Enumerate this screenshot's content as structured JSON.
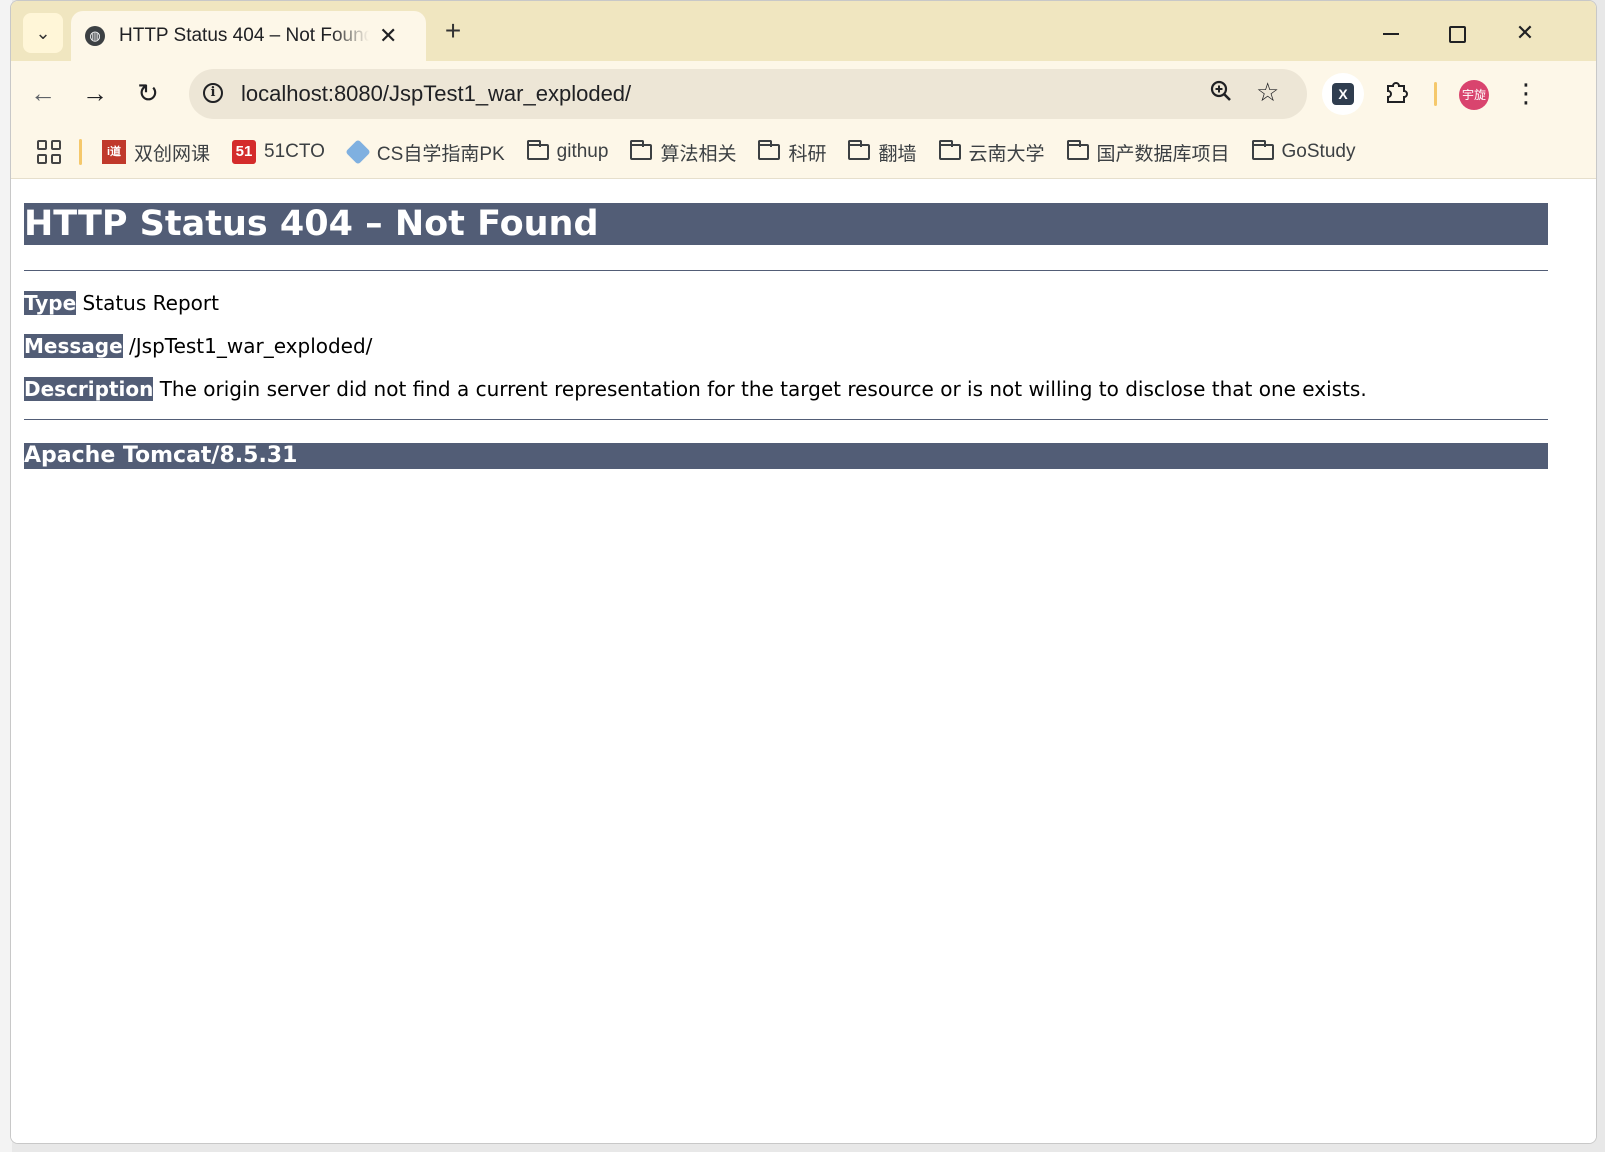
{
  "tab": {
    "title": "HTTP Status 404 – Not Found",
    "close": "✕"
  },
  "window_controls": {
    "minimize": "—",
    "maximize": "☐",
    "close": "✕"
  },
  "toolbar": {
    "url": "localhost:8080/JspTest1_war_exploded/",
    "avatar_text": "宇旋"
  },
  "bookmarks": [
    {
      "label": "双创网课",
      "icon": "shuangchuang-icon"
    },
    {
      "label": "51CTO",
      "icon": "51cto-icon"
    },
    {
      "label": "CS自学指南PK",
      "icon": "cube-icon"
    },
    {
      "label": "githup",
      "icon": "folder-icon"
    },
    {
      "label": "算法相关",
      "icon": "folder-icon"
    },
    {
      "label": "科研",
      "icon": "folder-icon"
    },
    {
      "label": "翻墙",
      "icon": "folder-icon"
    },
    {
      "label": "云南大学",
      "icon": "folder-icon"
    },
    {
      "label": "国产数据库项目",
      "icon": "folder-icon"
    },
    {
      "label": "GoStudy",
      "icon": "folder-icon"
    }
  ],
  "page": {
    "heading": "HTTP Status 404 – Not Found",
    "type_label": "Type",
    "type_value": "Status Report",
    "message_label": "Message",
    "message_value": "/JspTest1_war_exploded/",
    "description_label": "Description",
    "description_value": "The origin server did not find a current representation for the target resource or is not willing to disclose that one exists.",
    "footer": "Apache Tomcat/8.5.31"
  },
  "colors": {
    "tomcat_header": "#525d76",
    "chrome_frame": "#f0e6c0",
    "toolbar": "#fdf7e8"
  }
}
